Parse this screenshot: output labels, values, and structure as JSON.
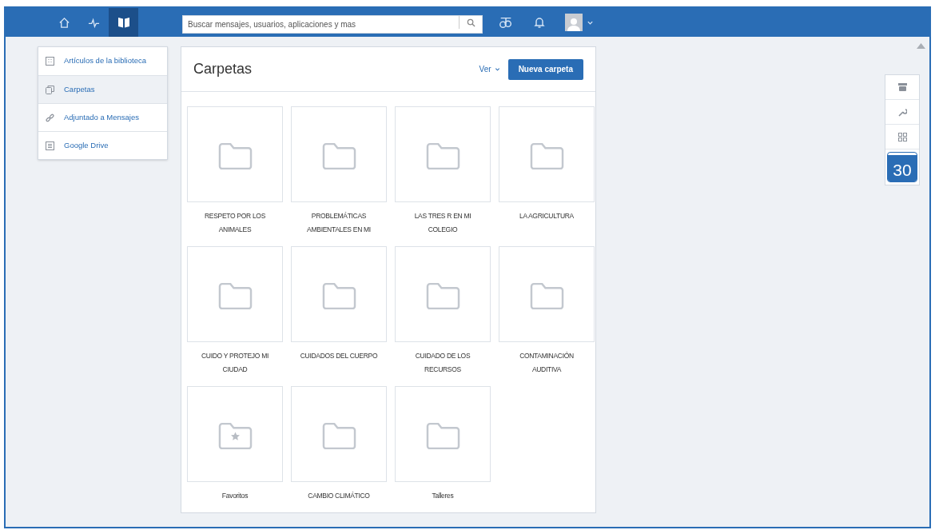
{
  "top_nav": [
    {
      "kind": "home",
      "selected": false
    },
    {
      "kind": "activity",
      "selected": false
    },
    {
      "kind": "library",
      "selected": true
    }
  ],
  "search": {
    "placeholder": "Buscar mensajes, usuarios, aplicaciones y mas"
  },
  "sidebar": {
    "items": [
      {
        "kind": "articles",
        "label": "Artículos de la biblioteca",
        "selected": false
      },
      {
        "kind": "folders",
        "label": "Carpetas",
        "selected": true
      },
      {
        "kind": "attachments",
        "label": "Adjuntado a Mensajes",
        "selected": false
      },
      {
        "kind": "drive",
        "label": "Google Drive",
        "selected": false
      }
    ]
  },
  "panel": {
    "title": "Carpetas",
    "view_label": "Ver",
    "new_button": "Nueva carpeta",
    "folders": [
      {
        "kind": "folder",
        "label": "RESPETO POR LOS ANIMALES"
      },
      {
        "kind": "folder",
        "label": "PROBLEMÁTICAS AMBIENTALES EN MI"
      },
      {
        "kind": "folder",
        "label": "LAS TRES R EN MI COLEGIO"
      },
      {
        "kind": "folder",
        "label": "LA AGRICULTURA"
      },
      {
        "kind": "folder",
        "label": "CUIDO Y PROTEJO MI CIUDAD"
      },
      {
        "kind": "folder",
        "label": "CUIDADOS DEL CUERPO"
      },
      {
        "kind": "folder",
        "label": "CUIDADO DE LOS RECURSOS"
      },
      {
        "kind": "folder",
        "label": "CONTAMINACIÓN AUDITIVA"
      },
      {
        "kind": "favorites",
        "label": "Favoritos"
      },
      {
        "kind": "folder",
        "label": "CAMBIO CLIMÁTICO"
      },
      {
        "kind": "folder",
        "label": "Talleres"
      }
    ]
  },
  "side_tools": {
    "calendar_day": "30"
  }
}
